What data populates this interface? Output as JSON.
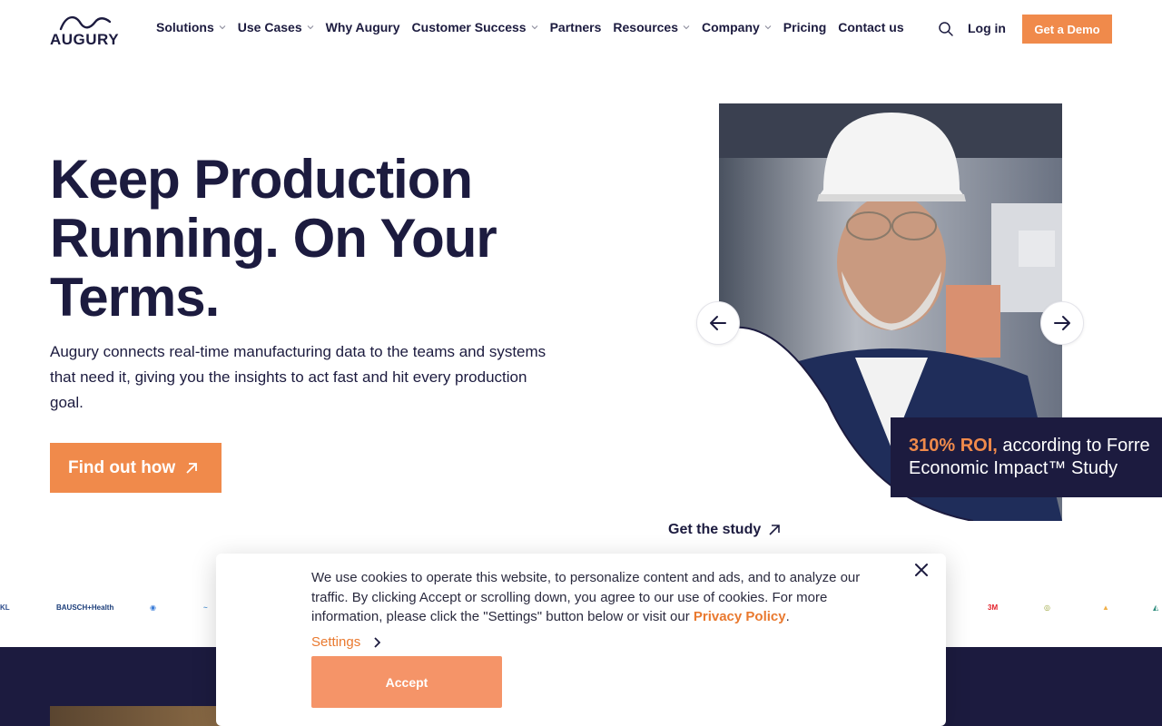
{
  "brand": {
    "name": "AUGURY",
    "accent": "#f08a4b",
    "navy": "#1c1b3f"
  },
  "nav": {
    "items": [
      {
        "label": "Solutions",
        "has_dropdown": true
      },
      {
        "label": "Use Cases",
        "has_dropdown": true
      },
      {
        "label": "Why Augury",
        "has_dropdown": false
      },
      {
        "label": "Customer Success",
        "has_dropdown": true
      },
      {
        "label": "Partners",
        "has_dropdown": false
      },
      {
        "label": "Resources",
        "has_dropdown": true
      },
      {
        "label": "Company",
        "has_dropdown": true
      },
      {
        "label": "Pricing",
        "has_dropdown": false
      },
      {
        "label": "Contact us",
        "has_dropdown": false
      }
    ],
    "search_icon": "search-icon",
    "login": "Log in",
    "demo": "Get a Demo"
  },
  "hero": {
    "title": "Keep Production Running. On Your Terms.",
    "subtitle": "Augury connects real-time manufacturing data to the teams and systems that need it, giving you the insights to act fast and hit every production goal.",
    "cta": "Find out how"
  },
  "carousel": {
    "prev_icon": "arrow-left-icon",
    "next_icon": "arrow-right-icon",
    "roi_highlight": "310% ROI,",
    "roi_rest": " according to Forre",
    "roi_line2": "Economic Impact™ Study",
    "study_link": "Get the study"
  },
  "logo_strip": [
    {
      "text": "KL",
      "color": "#2b4a8a"
    },
    {
      "text": "BAUSCH+Health",
      "color": "#1c3e7a"
    },
    {
      "text": "◉",
      "color": "#3b7dd8"
    },
    {
      "text": "~",
      "color": "#5a9bd6"
    },
    {
      "text": "3M",
      "color": "#e4212b"
    },
    {
      "text": "◎",
      "color": "#9aa43a"
    },
    {
      "text": "▲",
      "color": "#f0b04a"
    },
    {
      "text": "◭",
      "color": "#2a8a7a"
    }
  ],
  "cookie": {
    "text": "We use cookies to operate this website, to personalize content and ads, and to analyze our traffic. By clicking Accept or scrolling down, you agree to our use of cookies. For more information, please click the \"Settings\" button below or visit our ",
    "privacy_link": "Privacy Policy",
    "after_link": ".",
    "settings": "Settings",
    "accept": "Accept"
  }
}
